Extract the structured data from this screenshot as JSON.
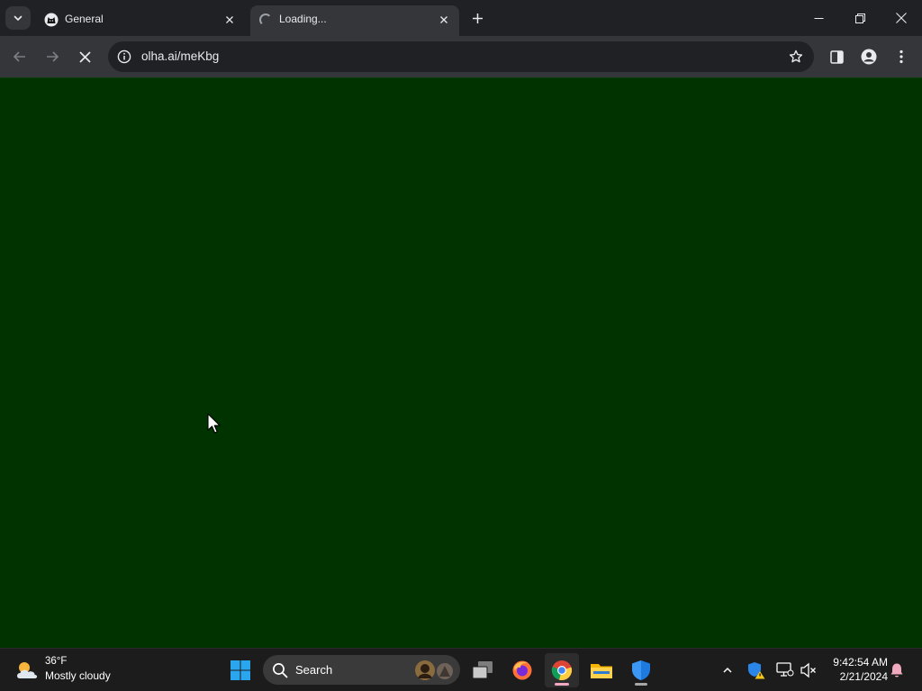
{
  "browser": {
    "tabs": [
      {
        "title": "General",
        "favicon": "cat-icon",
        "active": false
      },
      {
        "title": "Loading...",
        "favicon": "loading-spinner-icon",
        "active": true
      }
    ],
    "toolbar": {
      "url": "olha.ai/meKbg"
    }
  },
  "content": {
    "background_color": "#003300"
  },
  "taskbar": {
    "weather": {
      "temperature": "36°F",
      "condition": "Mostly cloudy"
    },
    "search_placeholder": "Search",
    "apps": [
      "windows-start-icon",
      "task-view-icon",
      "firefox-icon",
      "chrome-icon",
      "file-explorer-icon",
      "windows-security-icon"
    ],
    "clock": {
      "time": "9:42:54 AM",
      "date": "2/21/2024"
    }
  },
  "colors": {
    "tab_bar": "#202124",
    "toolbar": "#35363a",
    "page": "#003300",
    "taskbar": "#1c1c1c"
  }
}
